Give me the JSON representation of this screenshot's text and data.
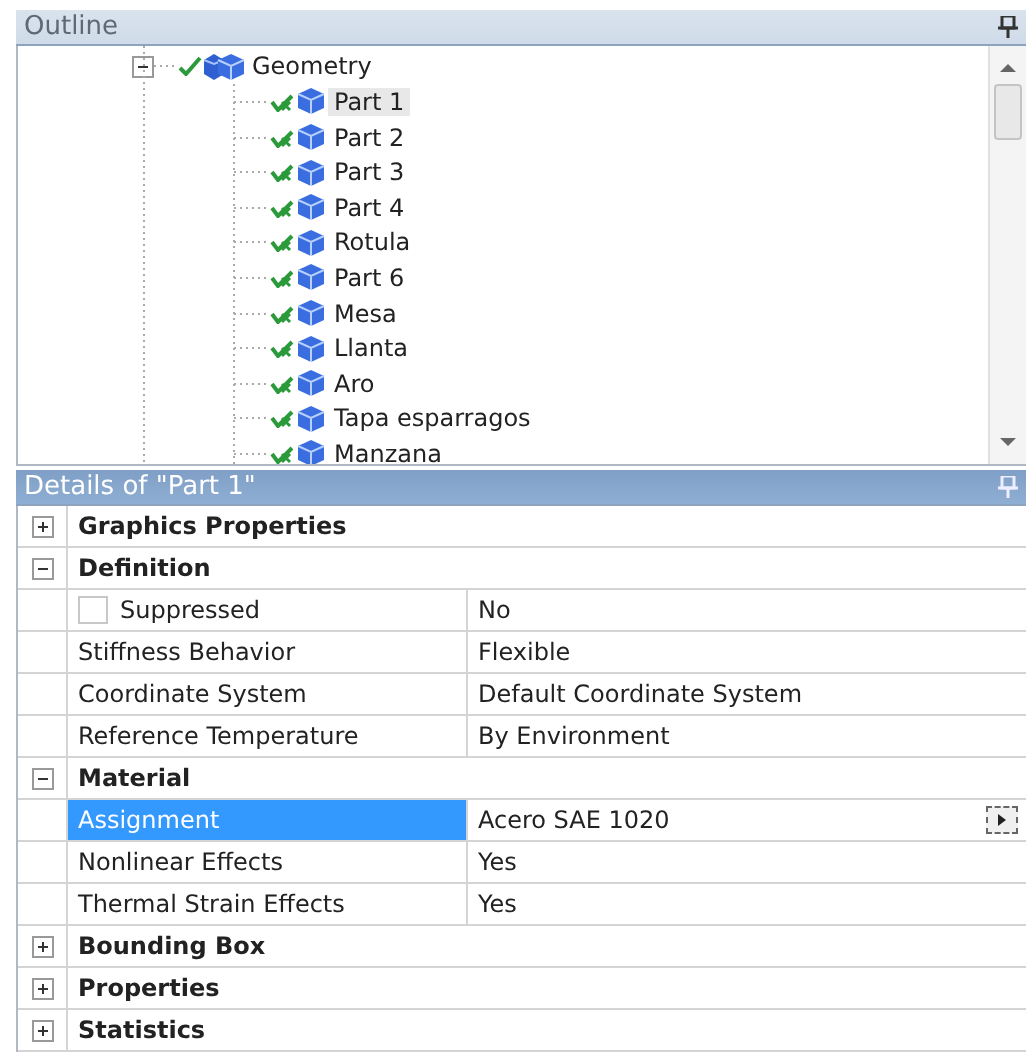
{
  "outline": {
    "title": "Outline",
    "tree": [
      {
        "label": "Geometry",
        "expanded": true,
        "children": [
          {
            "label": "Part 1",
            "selected": true
          },
          {
            "label": "Part 2",
            "selected": false
          },
          {
            "label": "Part 3",
            "selected": false
          },
          {
            "label": "Part 4",
            "selected": false
          },
          {
            "label": "Rotula",
            "selected": false
          },
          {
            "label": "Part 6",
            "selected": false
          },
          {
            "label": "Mesa",
            "selected": false
          },
          {
            "label": "Llanta",
            "selected": false
          },
          {
            "label": "Aro",
            "selected": false
          },
          {
            "label": "Tapa esparragos",
            "selected": false
          },
          {
            "label": "Manzana",
            "selected": false
          }
        ]
      }
    ]
  },
  "details": {
    "title": "Details of \"Part 1\"",
    "sections": [
      {
        "label": "Graphics Properties",
        "expanded": false
      },
      {
        "label": "Definition",
        "expanded": true,
        "rows": [
          {
            "kind": "checkbox",
            "name": "Suppressed",
            "value": "No",
            "checked": false,
            "selected": false
          },
          {
            "kind": "text",
            "name": "Stiffness Behavior",
            "value": "Flexible",
            "selected": false
          },
          {
            "kind": "text",
            "name": "Coordinate System",
            "value": "Default Coordinate System",
            "selected": false
          },
          {
            "kind": "text",
            "name": "Reference Temperature",
            "value": "By Environment",
            "selected": false
          }
        ]
      },
      {
        "label": "Material",
        "expanded": true,
        "rows": [
          {
            "kind": "picker",
            "name": "Assignment",
            "value": "Acero SAE 1020",
            "selected": true
          },
          {
            "kind": "text",
            "name": "Nonlinear Effects",
            "value": "Yes",
            "selected": false
          },
          {
            "kind": "text",
            "name": "Thermal Strain Effects",
            "value": "Yes",
            "selected": false
          }
        ]
      },
      {
        "label": "Bounding Box",
        "expanded": false
      },
      {
        "label": "Properties",
        "expanded": false
      },
      {
        "label": "Statistics",
        "expanded": false
      }
    ]
  }
}
